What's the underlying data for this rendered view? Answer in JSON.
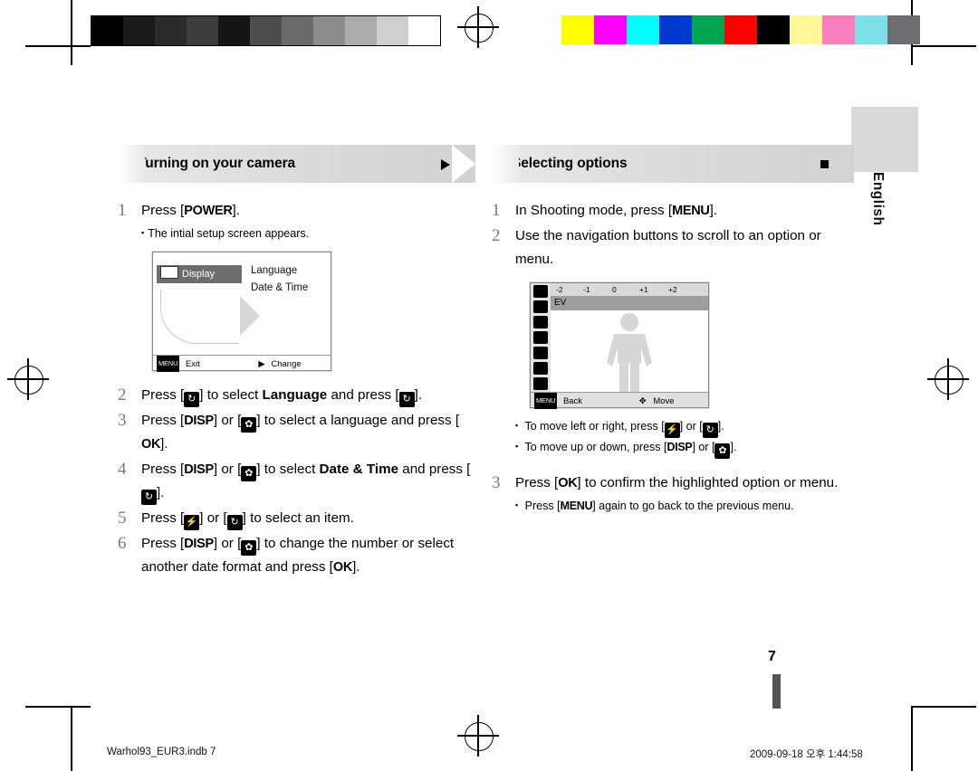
{
  "document": {
    "language_tab": "English",
    "page_number": "7",
    "footer_left": "Warhol93_EUR3.indb   7",
    "footer_right": "2009-09-18   오후 1:44:58"
  },
  "calibration": {
    "grayscale_swatches": [
      "#000000",
      "#1a1a1a",
      "#2b2b2b",
      "#3d3d3d",
      "#151515",
      "#4d4d4d",
      "#6a6a6a",
      "#8c8c8c",
      "#ababab",
      "#cfcfcf",
      "#ffffff"
    ],
    "color_swatches": [
      "#ffff00",
      "#ff00ff",
      "#00ffff",
      "#0038d0",
      "#00a651",
      "#ff0000",
      "#000000",
      "#fff799",
      "#f77fbe",
      "#7fdfe8",
      "#6d6e71"
    ]
  },
  "left_column": {
    "title": "Turning on your camera",
    "steps": [
      {
        "num": "1",
        "text_parts": [
          "Press [",
          "POWER",
          "]."
        ],
        "sub": [
          "The intial setup screen appears."
        ]
      },
      {
        "num": "2",
        "text": "Press [ ] to select Language and press [ ]."
      },
      {
        "num": "3",
        "text": "Press [DISP] or [ ] to select a language and press [OK]."
      },
      {
        "num": "4",
        "text": "Press [DISP] or [ ] to select Date & Time and press [ ]."
      },
      {
        "num": "5",
        "text": "Press [ ] or [ ] to select an item."
      },
      {
        "num": "6",
        "text": "Press [DISP] or [ ] to change the number or select another date format and press [OK]."
      }
    ],
    "lcd": {
      "tab_label": "Display",
      "menu_items": [
        "Language",
        "Date & Time"
      ],
      "footer_left_tag": "MENU",
      "footer_left_label": "Exit",
      "footer_right_label": "Change"
    }
  },
  "right_column": {
    "title": "Selecting options",
    "steps": [
      {
        "num": "1",
        "text": "In Shooting mode, press [MENU]."
      },
      {
        "num": "2",
        "text": "Use the navigation buttons to scroll to an option or menu."
      },
      {
        "num": "3",
        "text": "Press [OK] to confirm the highlighted option or menu.",
        "sub": [
          "Press [MENU] again to go back to the previous menu."
        ]
      }
    ],
    "notes": [
      "To move left or right, press [ ] or [ ].",
      "To move up or down, press [DISP] or [ ]."
    ],
    "lcd": {
      "scale_labels": [
        "-2",
        "-1",
        "0",
        "+1",
        "+2"
      ],
      "ev_label": "EV",
      "footer_left_tag": "MENU",
      "footer_left_label": "Back",
      "footer_right_label": "Move"
    }
  },
  "keys": {
    "power": "POWER",
    "disp": "DISP",
    "ok": "OK",
    "menu": "MENU"
  }
}
